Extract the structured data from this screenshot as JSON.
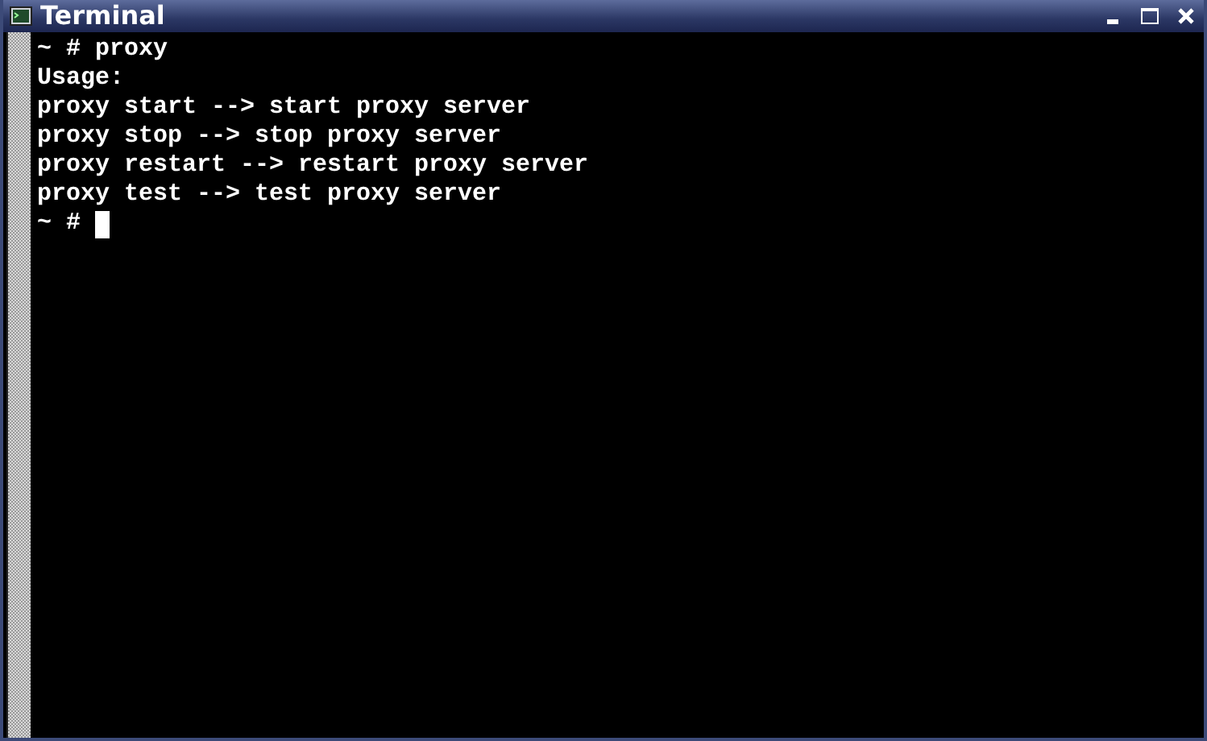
{
  "window": {
    "title": "Terminal"
  },
  "terminal": {
    "lines": [
      "~ # proxy",
      "Usage:",
      "proxy start --> start proxy server",
      "proxy stop --> stop proxy server",
      "proxy restart --> restart proxy server",
      "proxy test --> test proxy server"
    ],
    "prompt": {
      "text": "~ # ",
      "cursor": true
    }
  }
}
